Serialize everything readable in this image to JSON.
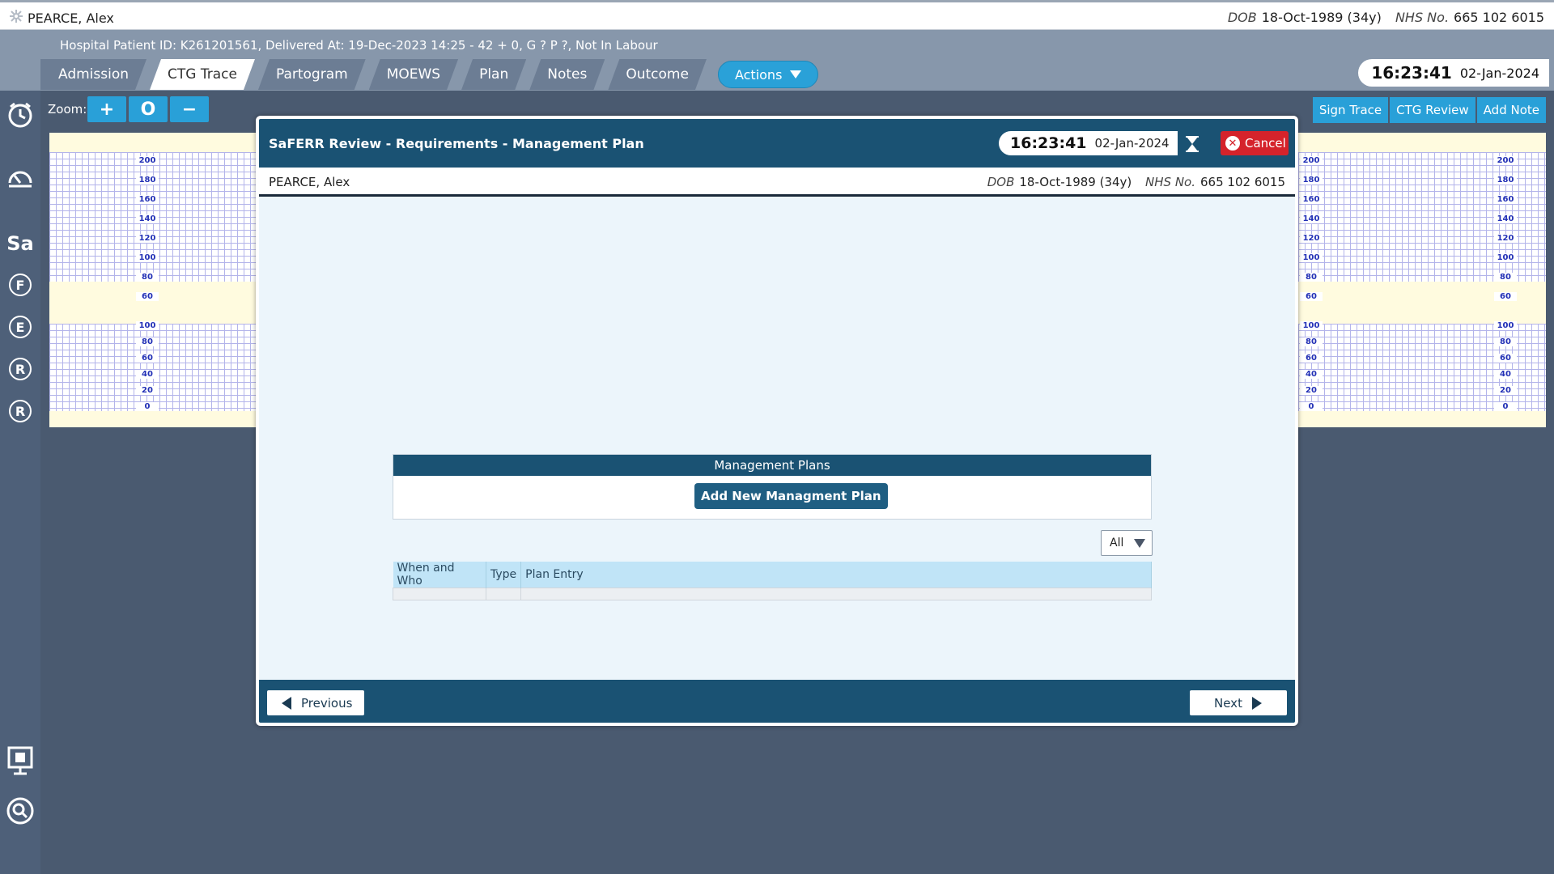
{
  "patient": {
    "name": "PEARCE, Alex",
    "dob_label": "DOB",
    "dob": "18-Oct-1989 (34y)",
    "nhs_label": "NHS No.",
    "nhs": "665 102 6015"
  },
  "header": {
    "hospital_line": "Hospital Patient ID: K261201561, Delivered At: 19-Dec-2023 14:25 - 42 + 0, G ? P ?,   Not In Labour",
    "tabs": [
      {
        "label": "Admission"
      },
      {
        "label": "CTG Trace"
      },
      {
        "label": "Partogram"
      },
      {
        "label": "MOEWS"
      },
      {
        "label": "Plan"
      },
      {
        "label": "Notes"
      },
      {
        "label": "Outcome"
      }
    ],
    "active_tab": "CTG Trace",
    "actions_label": "Actions",
    "time": "16:23:41",
    "date": "02-Jan-2024"
  },
  "sidebar": {
    "items": [
      {
        "icon": "clock-icon"
      },
      {
        "icon": "dashboard-alarm-icon"
      },
      {
        "label": "Sa"
      },
      {
        "label": "F"
      },
      {
        "label": "E"
      },
      {
        "label": "R"
      },
      {
        "label": "R"
      },
      {
        "icon": "presentation-icon"
      },
      {
        "icon": "search-icon"
      }
    ]
  },
  "toolbar": {
    "zoom_label": "Zoom:",
    "zoom_in": "+",
    "zoom_reset": "O",
    "zoom_out": "−",
    "sign_trace": "Sign Trace",
    "ctg_review": "CTG Review",
    "add_note": "Add Note"
  },
  "ctg": {
    "fhr_scale": [
      "200",
      "180",
      "160",
      "140",
      "120",
      "100",
      "80",
      "60"
    ],
    "toco_scale": [
      "100",
      "80",
      "60",
      "40",
      "20",
      "0"
    ]
  },
  "modal": {
    "title": "SaFERR Review - Requirements - Management Plan",
    "time": "16:23:41",
    "date": "02-Jan-2024",
    "cancel_label": "Cancel",
    "management_plans_title": "Management Plans",
    "add_plan_label": "Add New Managment Plan",
    "filter_value": "All",
    "table_headers": [
      "When and Who",
      "Type",
      "Plan Entry"
    ],
    "previous_label": "Previous",
    "next_label": "Next"
  },
  "colors": {
    "header_bg": "#8797ab",
    "modal_header": "#1a5273",
    "accent_blue": "#29a0d8",
    "cancel_red": "#d5232b",
    "grid_line": "#b3b4ea"
  }
}
